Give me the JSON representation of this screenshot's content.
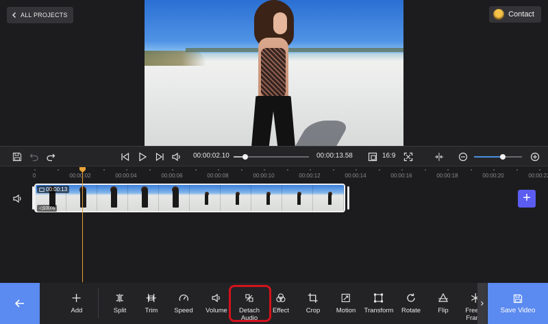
{
  "header": {
    "all_projects_label": "ALL PROJECTS",
    "contact_label": "Contact"
  },
  "controls": {
    "current_time": "00:00:02.10",
    "total_time": "00:00:13.58",
    "aspect_ratio": "16:9",
    "seek_progress": 0.15,
    "zoom_level": 0.6
  },
  "timeline": {
    "ruler": [
      "0",
      "00:00:02",
      "00:00:04",
      "00:00:06",
      "00:00:08",
      "00:00:10",
      "00:00:12",
      "00:00:14",
      "00:00:16",
      "00:00:18",
      "00:00:20",
      "00:00:22"
    ],
    "clip_duration": "00:00:13",
    "clip_volume": "100%"
  },
  "toolbar": {
    "add": "Add",
    "split": "Split",
    "trim": "Trim",
    "speed": "Speed",
    "volume": "Volume",
    "detach_audio_1": "Detach",
    "detach_audio_2": "Audio",
    "effect": "Effect",
    "crop": "Crop",
    "motion": "Motion",
    "transform": "Transform",
    "rotate": "Rotate",
    "flip": "Flip",
    "freeze_1": "Freeze",
    "freeze_2": "Frame",
    "save_video": "Save Video"
  },
  "icons": {
    "back": "arrow-left-icon",
    "save": "save-icon",
    "undo": "undo-icon",
    "redo": "redo-icon"
  },
  "colors": {
    "accent_blue": "#5b8af0",
    "playhead": "#e8a33a",
    "highlight_red": "#d4121c",
    "add_track": "#5b5cf0"
  }
}
